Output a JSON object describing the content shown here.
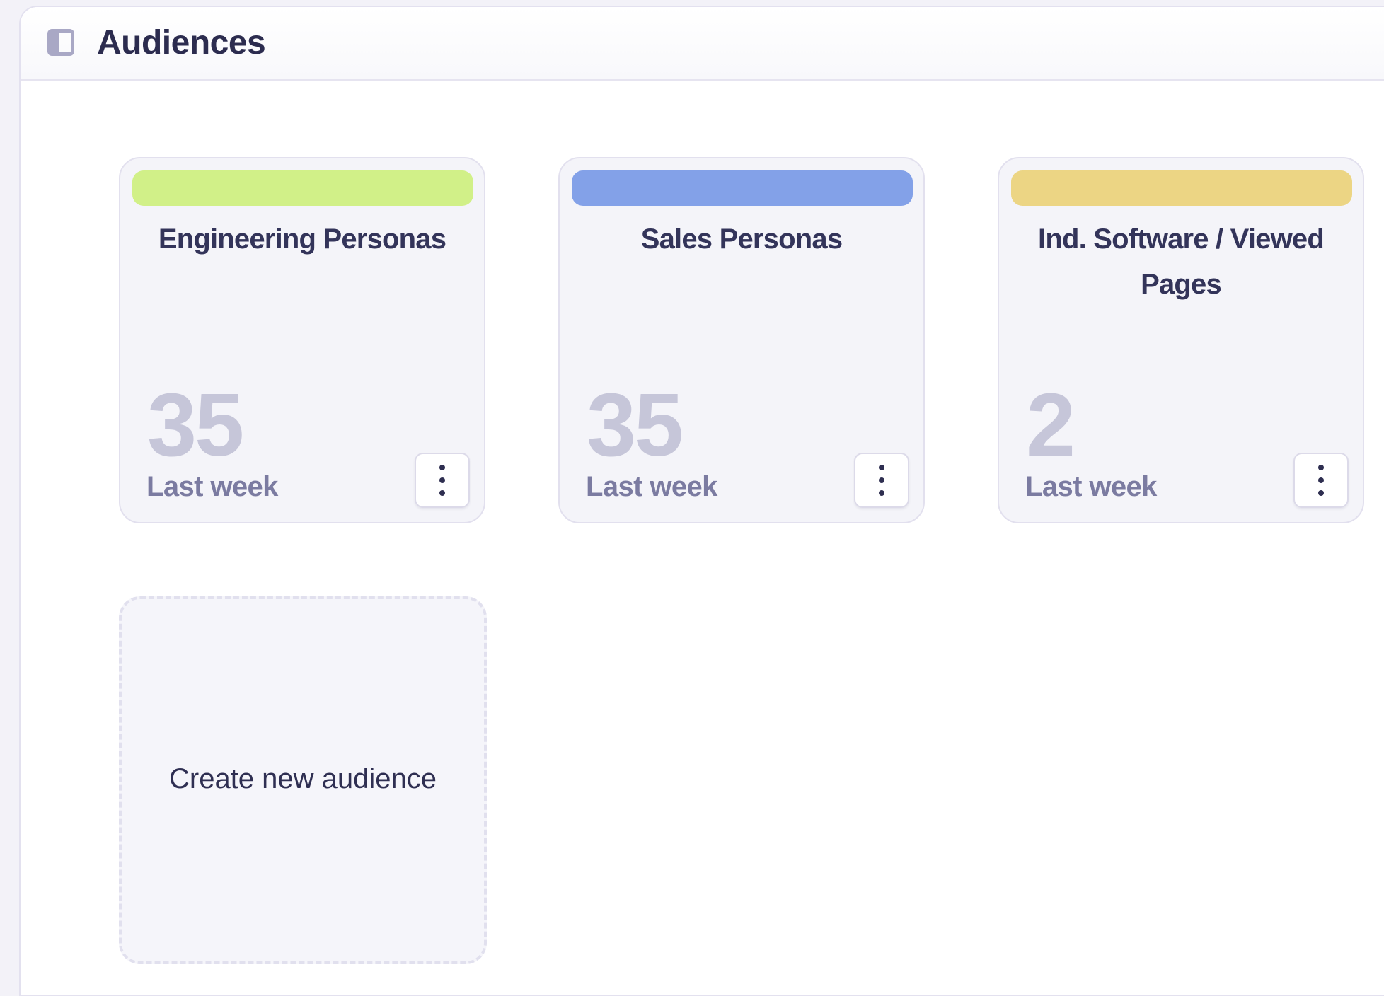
{
  "header": {
    "title": "Audiences",
    "toggle_icon": "sidebar-toggle-icon"
  },
  "colors": {
    "title_text": "#2c2c4f",
    "count_text": "#c6c6d9",
    "period_text": "#7b7ba1"
  },
  "audiences": [
    {
      "title": "Engineering Personas",
      "count": "35",
      "period": "Last week",
      "color": "#d1f088"
    },
    {
      "title": "Sales Personas",
      "count": "35",
      "period": "Last week",
      "color": "#83a1e8"
    },
    {
      "title": "Ind. Software / Viewed Pages",
      "count": "2",
      "period": "Last week",
      "color": "#ecd584"
    }
  ],
  "create": {
    "label": "Create new audience"
  }
}
